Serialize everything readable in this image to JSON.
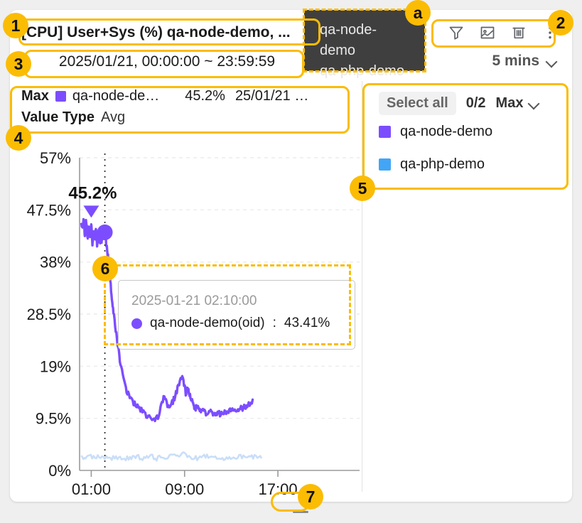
{
  "header": {
    "title": "[CPU] User+Sys (%) qa-node-demo, ...",
    "prev_label": "‹",
    "next_label": "›",
    "date_range": "2025/01/21, 00:00:00 ~ 23:59:59",
    "interval": "5 mins"
  },
  "toolbar": {
    "filter_icon": "filter-icon",
    "chart_icon": "chart-image-icon",
    "delete_icon": "trash-icon",
    "more_icon": "more-vertical-icon"
  },
  "hover_tooltip": {
    "lines": [
      "qa-node-demo",
      "qa-php-demo"
    ]
  },
  "stats": {
    "max_label": "Max",
    "series_name": "qa-node-de…",
    "max_value": "45.2%",
    "max_time": "25/01/21 …",
    "value_type_label": "Value Type",
    "value_type": "Avg"
  },
  "legend": {
    "select_all": "Select all",
    "count": "0/2",
    "aggregation": "Max",
    "items": [
      {
        "label": "qa-node-demo",
        "color": "#7C4DFF"
      },
      {
        "label": "qa-php-demo",
        "color": "#42A5F5"
      }
    ]
  },
  "chart_tooltip": {
    "time": "2025-01-21 02:10:00",
    "series": "qa-node-demo(oid)",
    "separator": " : ",
    "value": "43.41%",
    "color": "#7C4DFF"
  },
  "peak_annotation": {
    "label": "45.2%"
  },
  "resize_handle": {
    "label": ""
  },
  "annotations": [
    {
      "id": "1",
      "badge": "1"
    },
    {
      "id": "2",
      "badge": "2"
    },
    {
      "id": "3",
      "badge": "3"
    },
    {
      "id": "4",
      "badge": "4"
    },
    {
      "id": "5",
      "badge": "5"
    },
    {
      "id": "6",
      "badge": "6"
    },
    {
      "id": "7",
      "badge": "7"
    },
    {
      "id": "a",
      "badge": "a"
    }
  ],
  "chart_data": {
    "type": "line",
    "title": "[CPU] User+Sys (%) qa-node-demo, ...",
    "xlabel": "",
    "ylabel": "",
    "grid": true,
    "legend_position": "right",
    "ylim": [
      0,
      57
    ],
    "yticks": [
      "0%",
      "9.5%",
      "19%",
      "28.5%",
      "38%",
      "47.5%",
      "57%"
    ],
    "ytick_values": [
      0,
      9.5,
      19,
      28.5,
      38,
      47.5,
      57
    ],
    "xticks": [
      "01:00",
      "09:00",
      "17:00"
    ],
    "xtick_values": [
      1,
      9,
      17
    ],
    "xlim": [
      0,
      24
    ],
    "marker_point": {
      "x": 2.1666,
      "y": 43.41,
      "label": "45.2%"
    },
    "cursor_line_x": 2.1666,
    "series": [
      {
        "name": "qa-node-demo",
        "color": "#7C4DFF",
        "x": [
          0.15,
          0.25,
          0.35,
          0.45,
          0.55,
          0.62,
          0.7,
          0.8,
          0.9,
          1.0,
          1.1,
          1.2,
          1.3,
          1.4,
          1.5,
          1.6,
          1.7,
          1.8,
          1.9,
          2.0,
          2.1,
          2.17,
          2.3,
          2.5,
          2.7,
          2.9,
          3.2,
          3.5,
          3.9,
          4.3,
          4.8,
          5.3,
          5.8,
          6.3,
          6.8,
          7.2,
          7.6,
          8.0,
          8.4,
          8.8,
          9.1,
          9.3,
          9.5,
          9.7,
          9.9,
          10.2,
          10.5,
          10.9,
          11.3,
          11.7,
          12.1,
          12.5,
          12.9,
          13.3,
          13.7,
          14.1,
          14.5,
          14.9,
          15.3,
          15.7
        ],
        "y": [
          45.0,
          44.2,
          45.5,
          43.0,
          45.2,
          44.0,
          42.0,
          44.5,
          42.5,
          44.8,
          41.5,
          43.5,
          42.0,
          44.0,
          41.0,
          43.0,
          42.5,
          41.0,
          42.2,
          42.8,
          43.9,
          43.41,
          41.0,
          38.0,
          33.0,
          29.0,
          24.0,
          19.5,
          15.5,
          13.0,
          12.0,
          11.0,
          10.0,
          9.3,
          10.0,
          13.5,
          11.8,
          12.5,
          15.0,
          17.5,
          14.2,
          15.0,
          13.5,
          12.0,
          11.5,
          11.2,
          10.8,
          10.5,
          10.6,
          10.4,
          10.3,
          10.5,
          10.8,
          11.0,
          11.2,
          11.5,
          12.0,
          12.8
        ]
      },
      {
        "name": "qa-php-demo",
        "color": "#C9DEF8",
        "x": [
          0.15,
          0.6,
          1.2,
          1.8,
          2.4,
          3.0,
          3.6,
          4.2,
          4.8,
          5.4,
          6.0,
          6.6,
          7.2,
          7.8,
          8.4,
          9.0,
          9.6,
          10.2,
          10.8,
          11.4,
          12.0,
          12.6,
          13.2,
          13.8,
          14.4,
          15.0,
          15.6
        ],
        "y": [
          2.4,
          2.2,
          2.6,
          2.3,
          2.5,
          2.2,
          2.4,
          2.1,
          2.5,
          2.3,
          2.6,
          2.2,
          2.4,
          2.7,
          2.3,
          3.0,
          2.4,
          2.2,
          2.6,
          2.3,
          2.5,
          2.1,
          2.4,
          2.6,
          2.3,
          2.5,
          2.2
        ]
      }
    ]
  }
}
